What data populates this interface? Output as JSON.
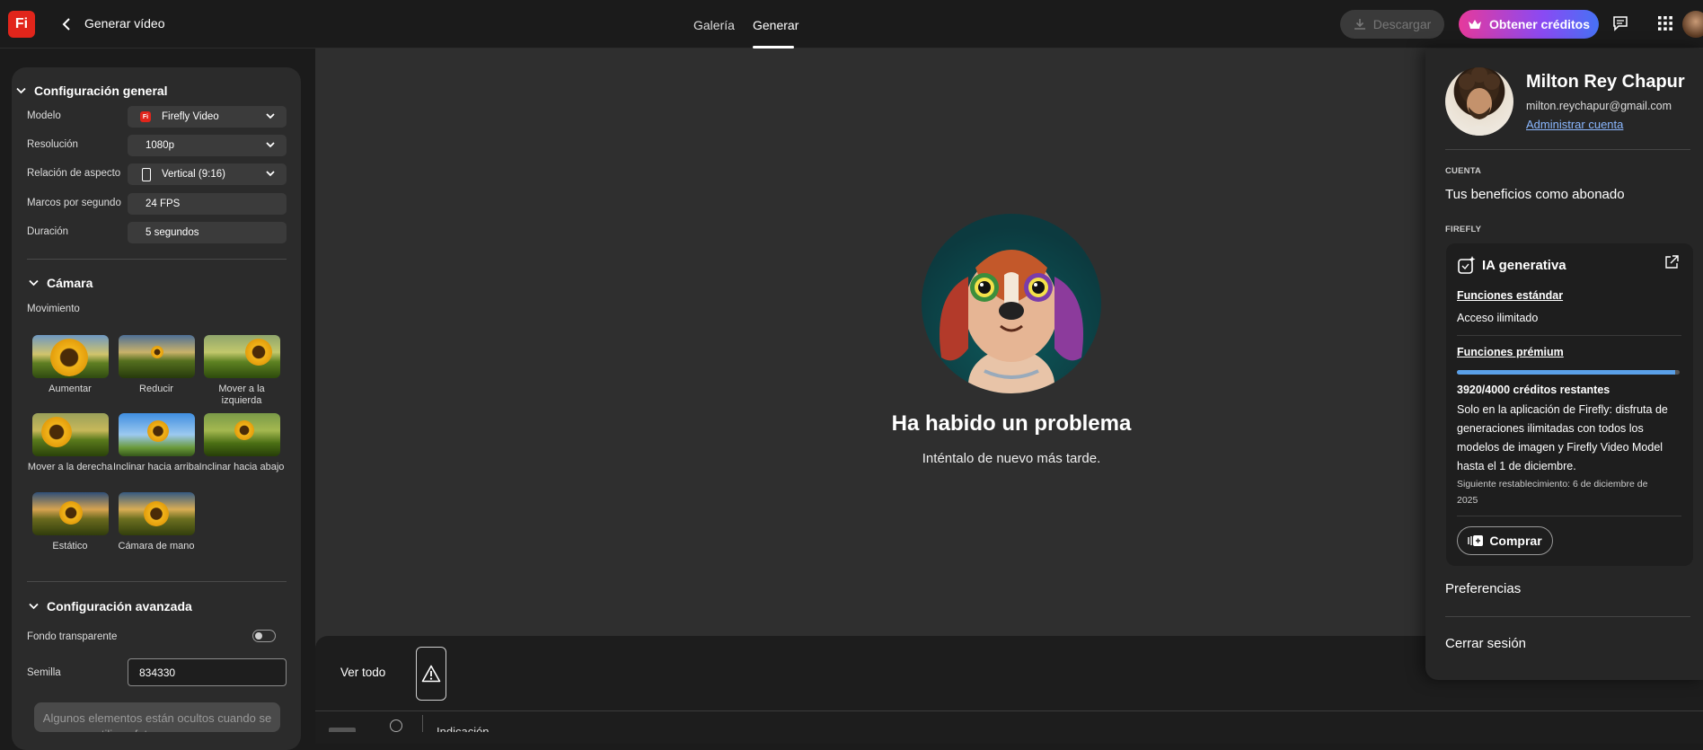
{
  "header": {
    "logo_text": "Fi",
    "title": "Generar vídeo",
    "tabs": [
      {
        "label": "Galería"
      },
      {
        "label": "Generar"
      }
    ],
    "active_tab": "Generar",
    "download_label": "Descargar",
    "credits_label": "Obtener créditos"
  },
  "sidebar": {
    "general": {
      "heading": "Configuración general",
      "rows": [
        {
          "label": "Modelo",
          "value": "Firefly Video"
        },
        {
          "label": "Resolución",
          "value": "1080p"
        },
        {
          "label": "Relación de aspecto",
          "value": "Vertical (9:16)"
        },
        {
          "label": "Marcos por segundo",
          "value": "24 FPS"
        },
        {
          "label": "Duración",
          "value": "5 segundos"
        }
      ]
    },
    "camera": {
      "heading": "Cámara",
      "subheading": "Movimiento",
      "moves": [
        "Aumentar",
        "Reducir",
        "Mover a la izquierda",
        "Mover a la derecha",
        "Inclinar hacia arriba",
        "Inclinar hacia abajo",
        "Estático",
        "Cámara de mano"
      ]
    },
    "advanced": {
      "heading": "Configuración avanzada",
      "transparent_label": "Fondo transparente",
      "transparent_on": false,
      "seed_label": "Semilla",
      "seed_value": "834330"
    },
    "notice": "Algunos elementos están ocultos cuando se utilizan fotogramas para"
  },
  "main": {
    "error_title": "Ha habido un problema",
    "error_message": "Inténtalo de nuevo más tarde.",
    "view_all_label": "Ver todo",
    "prompt_label": "Indicación"
  },
  "account": {
    "name": "Milton Rey Chapur",
    "email": "milton.reychapur@gmail.com",
    "manage_label": "Administrar cuenta",
    "section_account": "CUENTA",
    "benefits_label": "Tus beneficios como abonado",
    "section_firefly": "FIREFLY",
    "card": {
      "title": "IA generativa",
      "standard_heading": "Funciones estándar",
      "standard_value": "Acceso ilimitado",
      "premium_heading": "Funciones prémium",
      "credits_used_fraction": 0.98,
      "credits_text": "3920/4000 créditos restantes",
      "promo_lines": [
        "Solo en la aplicación de Firefly: disfruta de",
        "generaciones ilimitadas con todos los",
        "modelos de imagen y Firefly Video Model",
        "hasta el 1 de diciembre."
      ],
      "reset_lines": [
        "Siguiente restablecimiento: 6 de diciembre de",
        "2025"
      ],
      "buy_label": "Comprar"
    },
    "preferences_label": "Preferencias",
    "signout_label": "Cerrar sesión"
  },
  "colors": {
    "brand": "#e1251b",
    "link": "#8bb8ff",
    "progress": "#5aa0e8"
  }
}
